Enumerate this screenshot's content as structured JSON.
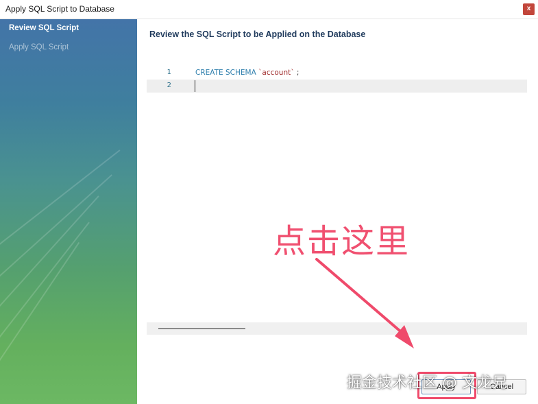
{
  "window": {
    "title": "Apply SQL Script to Database",
    "close_label": "x"
  },
  "sidebar": {
    "steps": [
      {
        "label": "Review SQL Script",
        "active": true
      },
      {
        "label": "Apply SQL Script",
        "active": false
      }
    ]
  },
  "main": {
    "heading": "Review the SQL Script to be Applied on the Database",
    "editor": {
      "lines": [
        {
          "number": "1",
          "keyword": "CREATE SCHEMA",
          "identifier": "`account`",
          "terminator": ";"
        },
        {
          "number": "2",
          "keyword": "",
          "identifier": "",
          "terminator": ""
        }
      ]
    }
  },
  "footer": {
    "apply_label": "Apply",
    "cancel_label": "Cancel"
  },
  "annotation": {
    "text": "点击这里",
    "color": "#f05070"
  },
  "watermark": {
    "text": "掘金技术社区 @ 文龙兄"
  }
}
